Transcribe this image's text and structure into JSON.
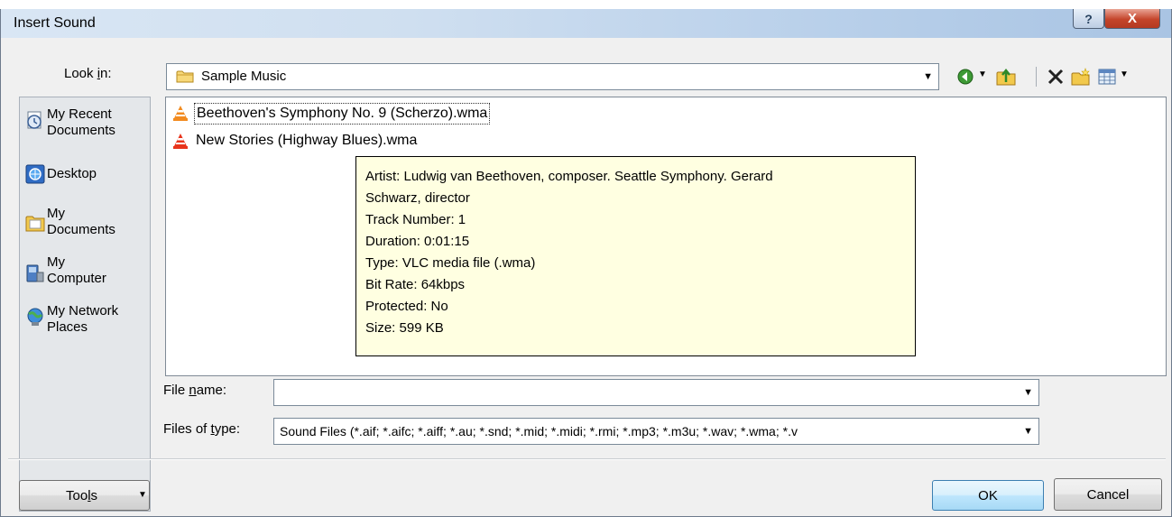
{
  "window": {
    "title": "Insert Sound",
    "help_glyph": "?",
    "close_glyph": "X"
  },
  "lookin": {
    "label_pre": "Look ",
    "label_key": "i",
    "label_post": "n:",
    "value": "Sample Music",
    "arrow": "▼"
  },
  "toolbar": {
    "back_arrow": "▼",
    "views_arrow": "▼"
  },
  "places": [
    {
      "label": "My Recent\nDocuments",
      "icon": "recent-documents-icon"
    },
    {
      "label": "Desktop",
      "icon": "desktop-icon"
    },
    {
      "label": "My\nDocuments",
      "icon": "my-documents-icon"
    },
    {
      "label": "My\nComputer",
      "icon": "my-computer-icon"
    },
    {
      "label": "My Network\nPlaces",
      "icon": "network-places-icon"
    }
  ],
  "files": [
    {
      "name": "Beethoven's Symphony No. 9 (Scherzo).wma",
      "selected": true
    },
    {
      "name": "New Stories (Highway Blues).wma",
      "selected": false
    }
  ],
  "tooltip": {
    "lines": [
      "Artist: Ludwig van Beethoven, composer. Seattle Symphony. Gerard",
      "Schwarz, director",
      "Track Number: 1",
      "Duration: 0:01:15",
      "Type: VLC media file (.wma)",
      "Bit Rate: 64kbps",
      "Protected: No",
      "Size: 599 KB"
    ]
  },
  "filename": {
    "label_pre": "File ",
    "label_key": "n",
    "label_post": "ame:",
    "value": "",
    "arrow": "▼"
  },
  "filetype": {
    "label_pre": "Files of ",
    "label_key": "t",
    "label_post": "ype:",
    "value": "Sound Files (*.aif; *.aifc; *.aiff; *.au; *.snd; *.mid; *.midi; *.rmi; *.mp3; *.m3u; *.wav; *.wma; *.v",
    "arrow": "▼"
  },
  "buttons": {
    "tools_pre": "Too",
    "tools_key": "l",
    "tools_post": "s",
    "tools_arrow": "▼",
    "ok": "OK",
    "cancel": "Cancel"
  }
}
